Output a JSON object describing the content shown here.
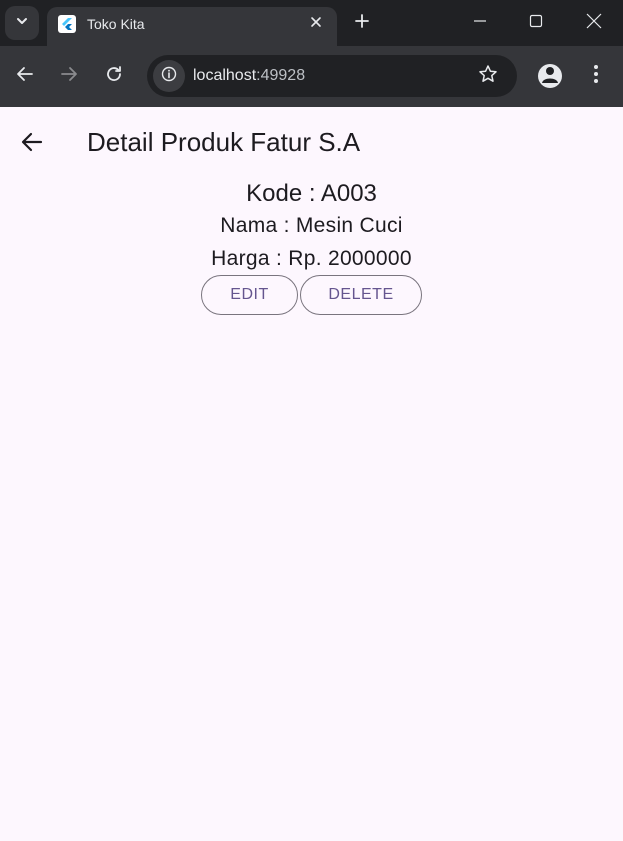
{
  "browser": {
    "tab": {
      "title": "Toko Kita"
    },
    "address": {
      "host": "localhost",
      "port": ":49928"
    }
  },
  "page": {
    "title": "Detail Produk Fatur S.A",
    "product": {
      "kode": "Kode : A003",
      "nama": "Nama : Mesin Cuci",
      "harga": "Harga : Rp. 2000000"
    },
    "buttons": {
      "edit": "EDIT",
      "delete": "DELETE"
    }
  },
  "colors": {
    "page_background": "#fdf7fe",
    "button_text": "#65558f",
    "button_border": "#79747e",
    "chrome_dark": "#202124",
    "chrome_toolbar": "#35363a"
  },
  "icons": {
    "tab_search": "chevron-down-icon",
    "favicon": "flutter-logo-icon",
    "tab_close": "close-icon",
    "new_tab": "plus-icon",
    "minimize": "minimize-icon",
    "maximize": "maximize-icon",
    "close_window": "close-icon",
    "back": "arrow-left-icon",
    "forward": "arrow-right-icon",
    "reload": "reload-icon",
    "site_info": "info-icon",
    "bookmark": "star-icon",
    "profile": "profile-icon",
    "menu": "kebab-menu-icon",
    "app_back": "arrow-left-icon"
  }
}
